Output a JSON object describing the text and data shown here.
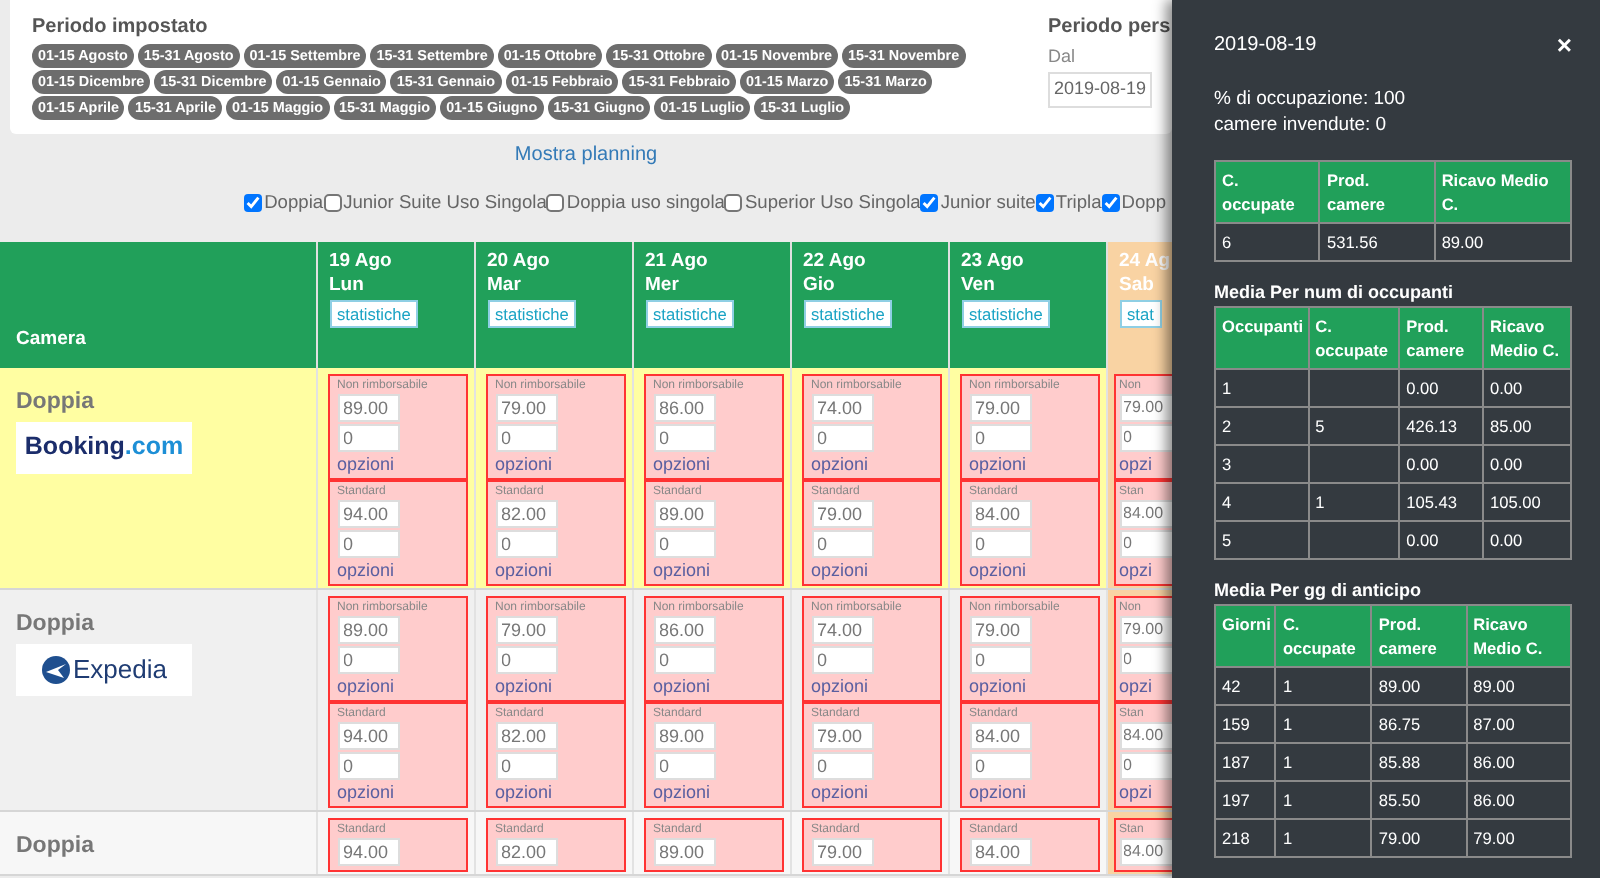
{
  "period": {
    "title": "Periodo impostato",
    "badge_rows": [
      [
        "01-15 Agosto",
        "15-31 Agosto",
        "01-15 Settembre",
        "15-31 Settembre",
        "01-15 Ottobre",
        "15-31 Ottobre",
        "01-15 Novembre",
        "15-31 Novembre"
      ],
      [
        "01-15 Dicembre",
        "15-31 Dicembre",
        "01-15 Gennaio",
        "15-31 Gennaio",
        "01-15 Febbraio",
        "15-31 Febbraio",
        "01-15 Marzo",
        "15-31 Marzo"
      ],
      [
        "01-15 Aprile",
        "15-31 Aprile",
        "01-15 Maggio",
        "15-31 Maggio",
        "01-15 Giugno",
        "15-31 Giugno",
        "01-15 Luglio",
        "15-31 Luglio"
      ]
    ]
  },
  "custom_period": {
    "title": "Periodo pers",
    "from_label": "Dal",
    "from_value": "2019-08-19"
  },
  "show_planning_link": "Mostra planning",
  "room_filters": [
    {
      "label": "Doppia",
      "checked": true
    },
    {
      "label": "Junior Suite Uso Singola",
      "checked": false
    },
    {
      "label": "Doppia uso singola",
      "checked": false
    },
    {
      "label": "Superior Uso Singola",
      "checked": false
    },
    {
      "label": "Junior suite",
      "checked": true
    },
    {
      "label": "Tripla",
      "checked": true
    },
    {
      "label": "Dopp",
      "checked": true
    }
  ],
  "grid": {
    "camera_header": "Camera",
    "days": [
      {
        "date": "19 Ago",
        "weekday": "Lun",
        "button": "statistiche",
        "weekend": false
      },
      {
        "date": "20 Ago",
        "weekday": "Mar",
        "button": "statistiche",
        "weekend": false
      },
      {
        "date": "21 Ago",
        "weekday": "Mer",
        "button": "statistiche",
        "weekend": false
      },
      {
        "date": "22 Ago",
        "weekday": "Gio",
        "button": "statistiche",
        "weekend": false
      },
      {
        "date": "23 Ago",
        "weekday": "Ven",
        "button": "statistiche",
        "weekend": false
      },
      {
        "date": "24 Ag",
        "weekday": "Sab",
        "button": "stat",
        "weekend": true
      }
    ],
    "rows": [
      {
        "room": "Doppia",
        "highlighted": true,
        "logo": {
          "kind": "booking",
          "parts": [
            "Booking",
            ".com"
          ]
        },
        "cells": [
          {
            "rates": [
              {
                "label": "Non rimborsabile",
                "price": "89.00",
                "qty": "0",
                "link": "opzioni"
              },
              {
                "label": "Standard",
                "price": "94.00",
                "qty": "0",
                "link": "opzioni"
              }
            ]
          },
          {
            "rates": [
              {
                "label": "Non rimborsabile",
                "price": "79.00",
                "qty": "0",
                "link": "opzioni"
              },
              {
                "label": "Standard",
                "price": "82.00",
                "qty": "0",
                "link": "opzioni"
              }
            ]
          },
          {
            "rates": [
              {
                "label": "Non rimborsabile",
                "price": "86.00",
                "qty": "0",
                "link": "opzioni"
              },
              {
                "label": "Standard",
                "price": "89.00",
                "qty": "0",
                "link": "opzioni"
              }
            ]
          },
          {
            "rates": [
              {
                "label": "Non rimborsabile",
                "price": "74.00",
                "qty": "0",
                "link": "opzioni"
              },
              {
                "label": "Standard",
                "price": "79.00",
                "qty": "0",
                "link": "opzioni"
              }
            ]
          },
          {
            "rates": [
              {
                "label": "Non rimborsabile",
                "price": "79.00",
                "qty": "0",
                "link": "opzioni"
              },
              {
                "label": "Standard",
                "price": "84.00",
                "qty": "0",
                "link": "opzioni"
              }
            ]
          },
          {
            "rates": [
              {
                "label": "Non",
                "price": "79.00",
                "qty": "0",
                "link": "opzi"
              },
              {
                "label": "Stan",
                "price": "84.00",
                "qty": "0",
                "link": "opzi"
              }
            ]
          }
        ]
      },
      {
        "room": "Doppia",
        "highlighted": false,
        "logo": {
          "kind": "expedia",
          "parts": [
            "Expedia"
          ]
        },
        "cells": [
          {
            "rates": [
              {
                "label": "Non rimborsabile",
                "price": "89.00",
                "qty": "0",
                "link": "opzioni"
              },
              {
                "label": "Standard",
                "price": "94.00",
                "qty": "0",
                "link": "opzioni"
              }
            ]
          },
          {
            "rates": [
              {
                "label": "Non rimborsabile",
                "price": "79.00",
                "qty": "0",
                "link": "opzioni"
              },
              {
                "label": "Standard",
                "price": "82.00",
                "qty": "0",
                "link": "opzioni"
              }
            ]
          },
          {
            "rates": [
              {
                "label": "Non rimborsabile",
                "price": "86.00",
                "qty": "0",
                "link": "opzioni"
              },
              {
                "label": "Standard",
                "price": "89.00",
                "qty": "0",
                "link": "opzioni"
              }
            ]
          },
          {
            "rates": [
              {
                "label": "Non rimborsabile",
                "price": "74.00",
                "qty": "0",
                "link": "opzioni"
              },
              {
                "label": "Standard",
                "price": "79.00",
                "qty": "0",
                "link": "opzioni"
              }
            ]
          },
          {
            "rates": [
              {
                "label": "Non rimborsabile",
                "price": "79.00",
                "qty": "0",
                "link": "opzioni"
              },
              {
                "label": "Standard",
                "price": "84.00",
                "qty": "0",
                "link": "opzioni"
              }
            ]
          },
          {
            "rates": [
              {
                "label": "Non",
                "price": "79.00",
                "qty": "0",
                "link": "opzi"
              },
              {
                "label": "Stan",
                "price": "84.00",
                "qty": "0",
                "link": "opzi"
              }
            ]
          }
        ]
      },
      {
        "room": "Doppia",
        "highlighted": false,
        "cells": [
          {
            "rates": [
              {
                "label": "Standard",
                "price": "94.00"
              }
            ]
          },
          {
            "rates": [
              {
                "label": "Standard",
                "price": "82.00"
              }
            ]
          },
          {
            "rates": [
              {
                "label": "Standard",
                "price": "89.00"
              }
            ]
          },
          {
            "rates": [
              {
                "label": "Standard",
                "price": "79.00"
              }
            ]
          },
          {
            "rates": [
              {
                "label": "Standard",
                "price": "84.00"
              }
            ]
          },
          {
            "rates": [
              {
                "label": "Stan",
                "price": "84.00"
              }
            ]
          }
        ]
      }
    ]
  },
  "stats_panel": {
    "date": "2019-08-19",
    "close": "×",
    "lines": [
      "% di occupazione: 100",
      "camere invendute: 0"
    ],
    "tables": [
      {
        "columns": [
          "C. occupate",
          "Prod. camere",
          "Ricavo Medio C."
        ],
        "rows": [
          [
            "6",
            "531.56",
            "89.00"
          ]
        ]
      },
      {
        "title": "Media Per num di occupanti",
        "columns": [
          "Occupanti",
          "C. occupate",
          "Prod. camere",
          "Ricavo Medio C."
        ],
        "rows": [
          [
            "1",
            null,
            "0.00",
            "0.00"
          ],
          [
            "2",
            "5",
            "426.13",
            "85.00"
          ],
          [
            "3",
            null,
            "0.00",
            "0.00"
          ],
          [
            "4",
            "1",
            "105.43",
            "105.00"
          ],
          [
            "5",
            null,
            "0.00",
            "0.00"
          ]
        ]
      },
      {
        "title": "Media Per gg di anticipo",
        "columns": [
          "Giorni",
          "C. occupate",
          "Prod. camere",
          "Ricavo Medio C."
        ],
        "rows": [
          [
            "42",
            "1",
            "89.00",
            "89.00"
          ],
          [
            "159",
            "1",
            "86.75",
            "87.00"
          ],
          [
            "187",
            "1",
            "85.88",
            "86.00"
          ],
          [
            "197",
            "1",
            "85.50",
            "86.00"
          ],
          [
            "218",
            "1",
            "79.00",
            "79.00"
          ]
        ]
      }
    ]
  }
}
